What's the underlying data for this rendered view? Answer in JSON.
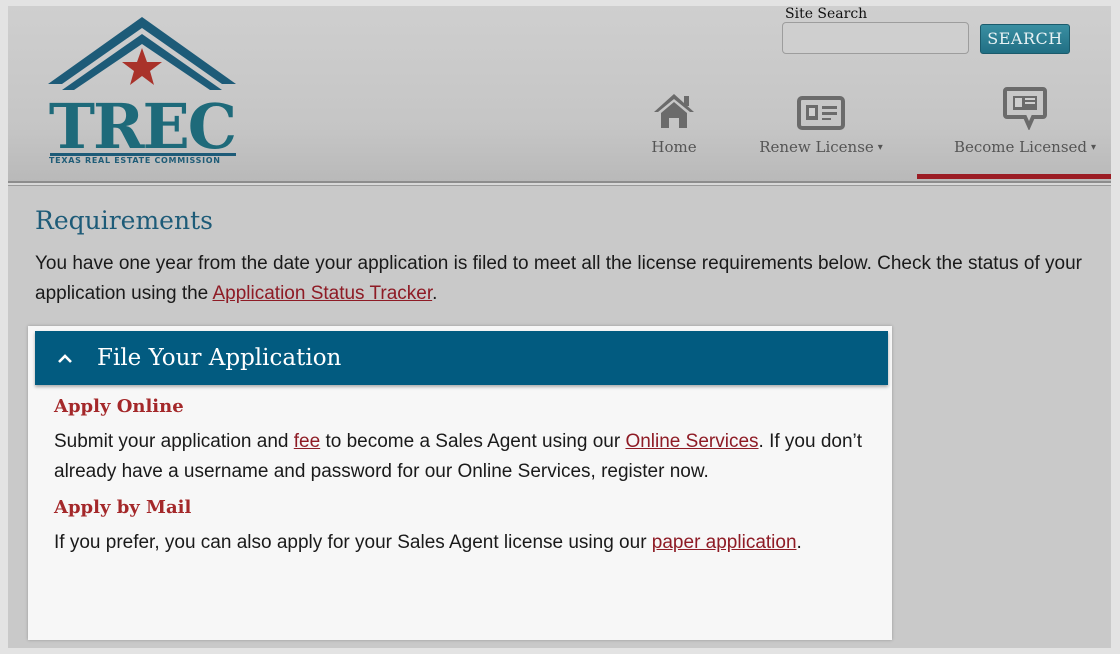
{
  "header": {
    "logo": {
      "title": "TREC",
      "subtitle": "TEXAS REAL ESTATE COMMISSION",
      "colors": {
        "teal": "#1e6a7a",
        "blue": "#1d5b78",
        "star": "#a9322a"
      }
    },
    "search": {
      "label": "Site Search",
      "placeholder": "",
      "value": "",
      "button_label": "SEARCH"
    },
    "nav": [
      {
        "label": "Home",
        "icon": "home-icon",
        "has_dropdown": false,
        "active": false
      },
      {
        "label": "Renew License",
        "icon": "id-card-icon",
        "has_dropdown": true,
        "active": false
      },
      {
        "label": "Become Licensed",
        "icon": "id-card-speech-bubble-icon",
        "has_dropdown": true,
        "active": true
      }
    ],
    "dropdown_caret": "▾"
  },
  "main": {
    "title": "Requirements",
    "intro": {
      "text_before": "You have one year from the date your application is filed to meet all the license requirements below. Check the status of your application using the ",
      "link": "Application Status Tracker",
      "text_after": "."
    },
    "accordion": {
      "title": "File Your Application",
      "expanded": true,
      "sections": [
        {
          "heading": "Apply Online",
          "p1_before": "Submit your application and ",
          "p1_link1": "fee",
          "p1_mid": " to become a Sales Agent using our ",
          "p1_link2": "Online Services",
          "p1_after": ".",
          "p2": "If you don’t already have a username and password for our Online Services, register now."
        },
        {
          "heading": "Apply by Mail",
          "p1_before": "If you prefer, you can also apply for your Sales Agent license using our ",
          "p1_link1": "paper application",
          "p1_after": "."
        }
      ]
    }
  },
  "colors": {
    "accent_blue": "#025b80",
    "link_red": "#8e1b25",
    "subheading_red": "#a4282a",
    "active_underline": "#9b1c24",
    "search_button": "#2a7d91"
  }
}
